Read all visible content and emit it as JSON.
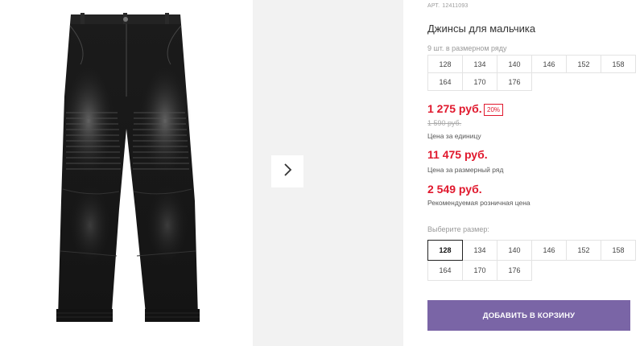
{
  "product": {
    "article_label": "АРТ.",
    "article_number": "12411093",
    "title": "Джинсы для мальчика",
    "size_row_note": "9 шт. в размерном ряду",
    "size_row_sizes": [
      "128",
      "134",
      "140",
      "146",
      "152",
      "158",
      "164",
      "170",
      "176"
    ],
    "price": "1 275 руб.",
    "discount": "20%",
    "old_price": "1 590 руб.",
    "price_unit_label": "Цена за единицу",
    "price_row": "11 475 руб.",
    "price_row_label": "Цена за размерный ряд",
    "retail_price": "2 549 руб.",
    "retail_price_label": "Рекомендуемая розничная цена",
    "choose_size_label": "Выберите размер:",
    "choose_sizes": [
      "128",
      "134",
      "140",
      "146",
      "152",
      "158",
      "164",
      "170",
      "176"
    ],
    "selected_size": "128",
    "add_to_cart": "ДОБАВИТЬ В КОРЗИНУ"
  },
  "colors": {
    "price_red": "#e0182d",
    "button_purple": "#7a65a6",
    "gallery_bg": "#f2f2f2",
    "denim": "#1e1e1e"
  },
  "icons": {
    "next": "chevron-right-icon"
  }
}
